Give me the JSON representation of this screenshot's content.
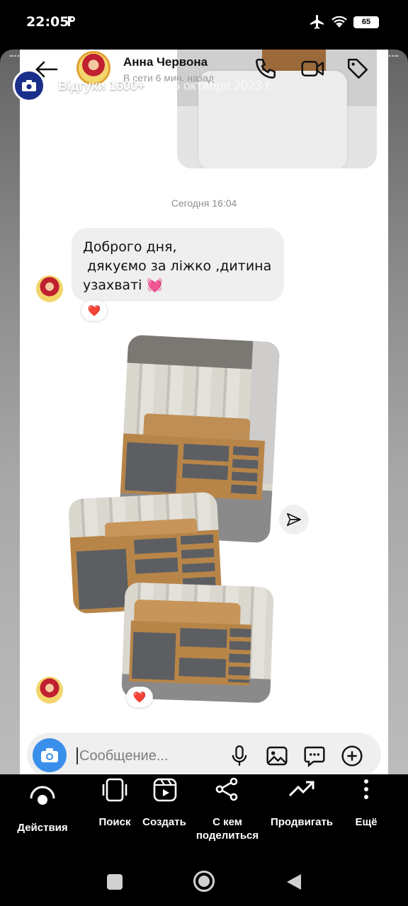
{
  "status_bar": {
    "time": "22:05",
    "battery": "65"
  },
  "chat_header": {
    "contact_name": "Анна Червона",
    "status": "В сети 6 мин. назад"
  },
  "story_overlay": {
    "title": "Відгуки 1600+",
    "date": "25 октября 2023 г."
  },
  "messages": {
    "timestamp": "Сегодня 16:04",
    "text": "Доброго дня,\n дякуємо за ліжко ,дитина узахваті 💓",
    "reaction": "❤️",
    "photo_reaction": "❤️"
  },
  "composer": {
    "placeholder": "Сообщение..."
  },
  "bottom_nav": {
    "actions": "Действия",
    "search": "Поиск",
    "create": "Создать",
    "share_with": "С кем\nподелиться",
    "promote": "Продвигать",
    "more": "Ещё"
  },
  "icons": {
    "back": "arrow-left-icon",
    "call": "phone-icon",
    "video": "video-icon",
    "tag": "tag-icon",
    "camera": "camera-icon",
    "mic": "mic-icon",
    "gallery": "image-icon",
    "sticker": "sticker-icon",
    "plus": "plus-icon",
    "send": "send-icon"
  },
  "colors": {
    "accent": "#3a8fea",
    "bubble": "#efefef",
    "heart": "#e0245e"
  }
}
